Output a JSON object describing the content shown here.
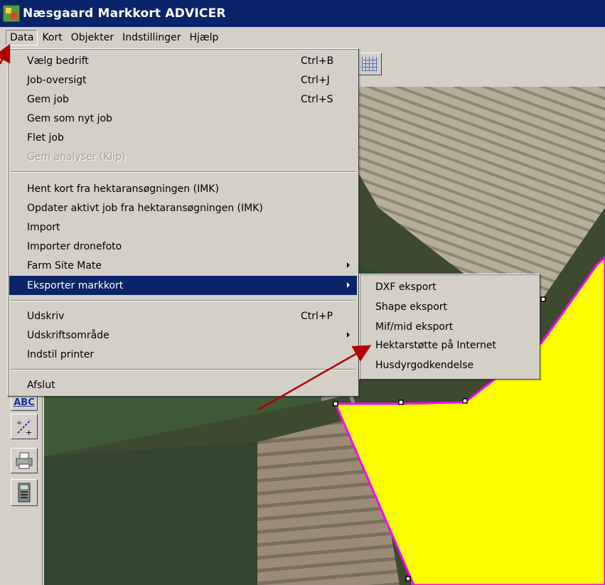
{
  "window": {
    "title": "Næsgaard Markkort ADVICER"
  },
  "menubar": {
    "items": [
      {
        "label": "Data"
      },
      {
        "label": "Kort"
      },
      {
        "label": "Objekter"
      },
      {
        "label": "Indstillinger"
      },
      {
        "label": "Hjælp"
      }
    ]
  },
  "data_menu": {
    "items": [
      {
        "label": "Vælg bedrift",
        "shortcut": "Ctrl+B"
      },
      {
        "label": "Job-oversigt",
        "shortcut": "Ctrl+J"
      },
      {
        "label": "Gem job",
        "shortcut": "Ctrl+S"
      },
      {
        "label": "Gem som nyt job"
      },
      {
        "label": "Flet job"
      },
      {
        "label": "Gem analyser (Klip)"
      },
      {
        "label": "Hent kort fra hektaransøgningen (IMK)"
      },
      {
        "label": "Opdater aktivt job fra hektaransøgningen (IMK)"
      },
      {
        "label": "Import"
      },
      {
        "label": "Importer dronefoto"
      },
      {
        "label": "Farm Site Mate"
      },
      {
        "label": "Eksporter markkort"
      },
      {
        "label": "Udskriv",
        "shortcut": "Ctrl+P"
      },
      {
        "label": "Udskriftsområde"
      },
      {
        "label": "Indstil printer"
      },
      {
        "label": "Afslut"
      }
    ]
  },
  "export_submenu": {
    "items": [
      {
        "label": "DXF eksport"
      },
      {
        "label": "Shape eksport"
      },
      {
        "label": "Mif/mid eksport"
      },
      {
        "label": "Hektarstøtte på Internet"
      },
      {
        "label": "Husdyrgodkendelse"
      }
    ]
  },
  "toolbar": {
    "partial_label": "ABC"
  },
  "colors": {
    "title_bar": "#0a246a",
    "menu_highlight": "#0a246a",
    "field_fill": "#ffff00",
    "field_border": "#ff00ff",
    "annotation_arrow": "#b00000"
  }
}
